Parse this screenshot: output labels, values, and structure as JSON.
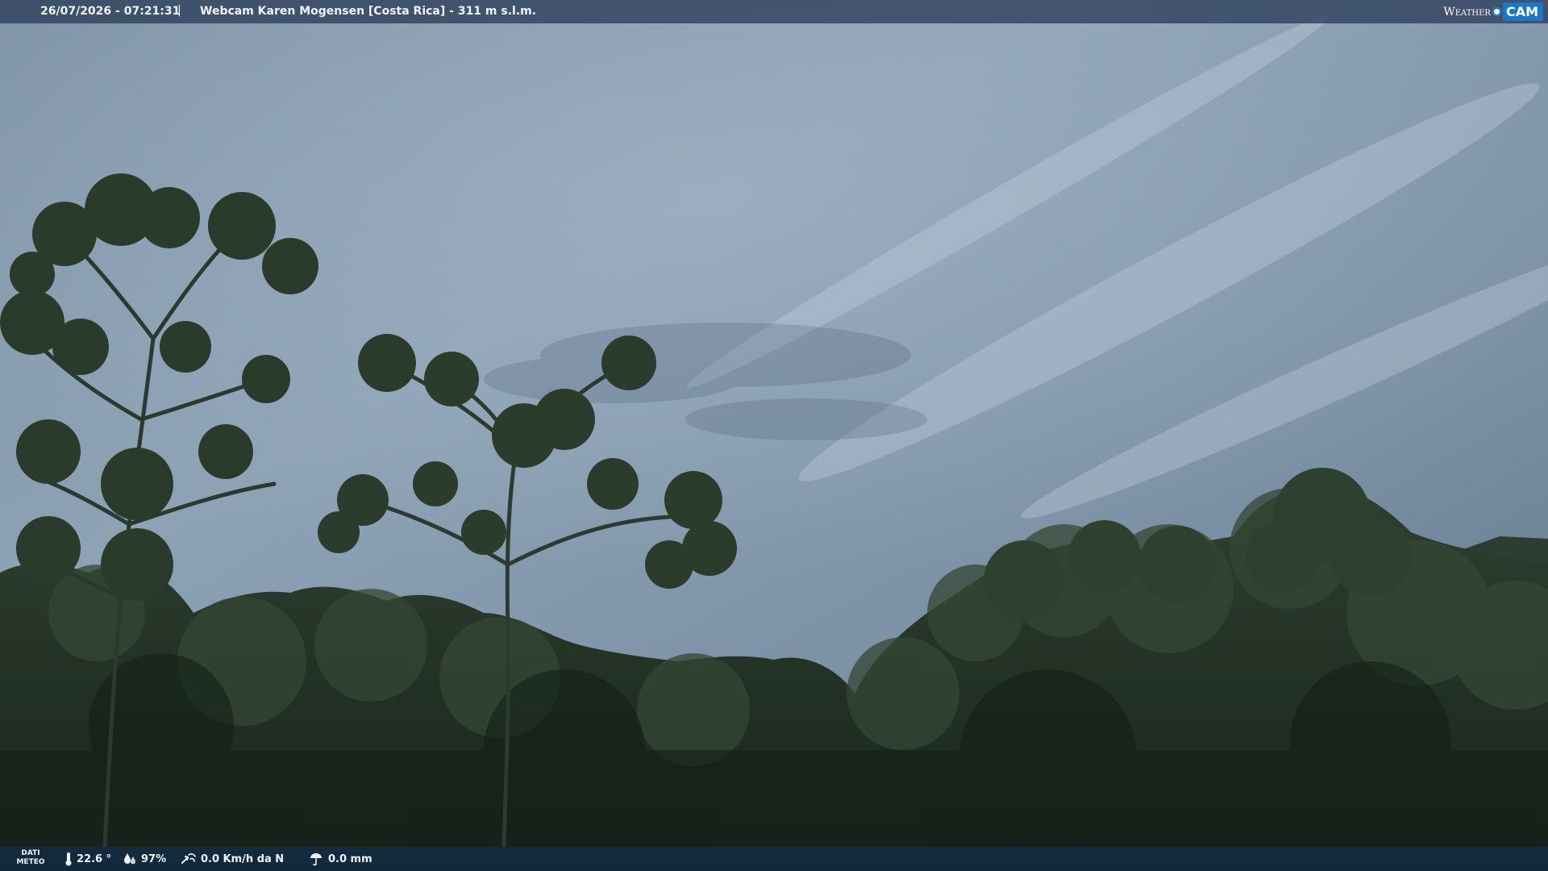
{
  "header": {
    "datetime": "26/07/2026 - 07:21:31",
    "separator": "|",
    "title": "Webcam Karen Mogensen [Costa Rica]  - 311 m s.l.m.",
    "logo_weather": "Weather",
    "logo_cam": "CAM"
  },
  "footer": {
    "dati_label_1": "DATI",
    "dati_label_2": "METEO",
    "temperature": "22.6 °",
    "humidity": "97%",
    "wind": "0.0 Km/h da N",
    "rain": "0.0 mm"
  },
  "icons": {
    "temperature": "thermometer-icon",
    "humidity": "droplets-icon",
    "wind": "wind-icon",
    "rain": "rain-gauge-icon"
  },
  "colors": {
    "sky_top": "#8fa3b8",
    "sky_bottom": "#6f8499",
    "foliage_dark": "#1f2d22",
    "foliage_mid": "#2c3d2c",
    "bar_top": "#2c3e58",
    "bar_bottom": "#122a42",
    "logo_blue": "#1b78c8"
  }
}
